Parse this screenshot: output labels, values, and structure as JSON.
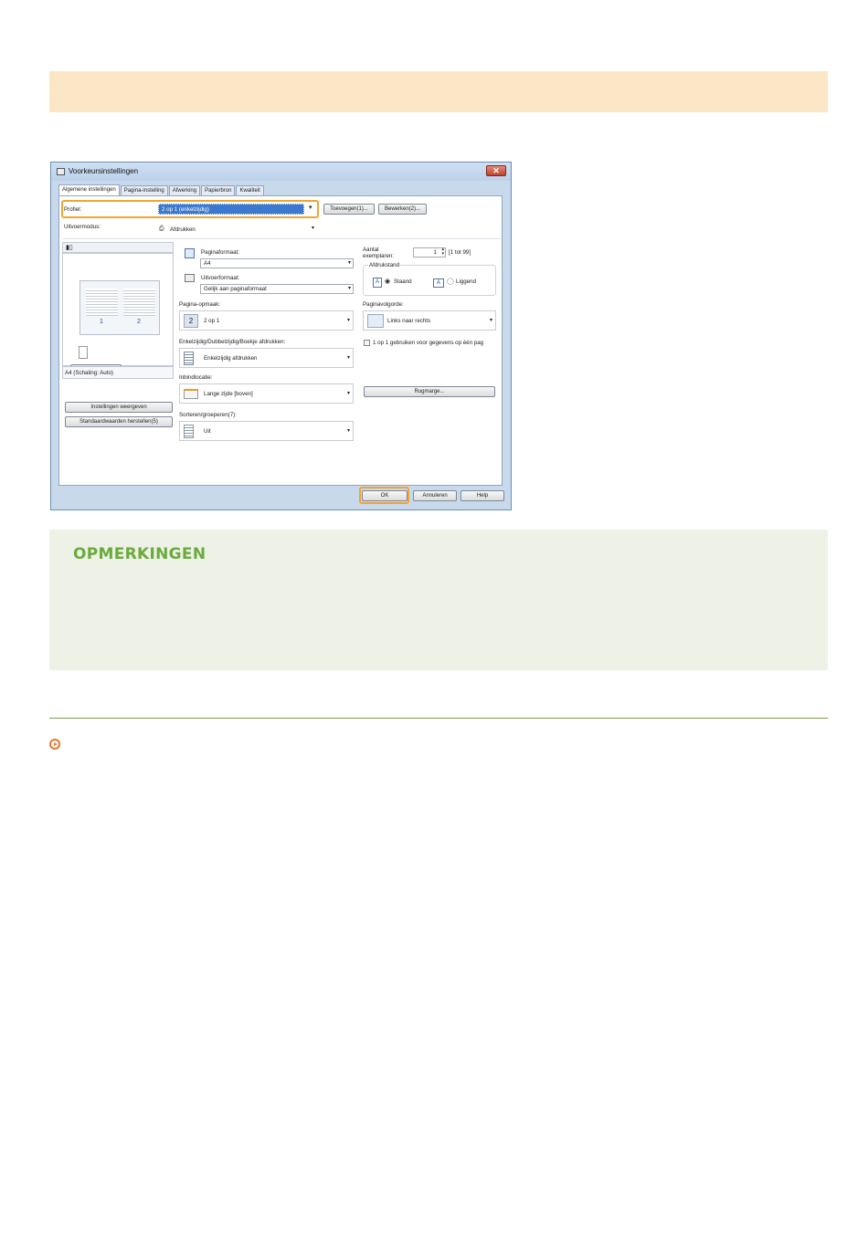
{
  "dialog": {
    "title": "Voorkeursinstellingen",
    "close": "✕",
    "tabs": [
      "Algemene instellingen",
      "Pagina-instelling",
      "Afwerking",
      "Papierbron",
      "Kwaliteit"
    ],
    "profile_label": "Profiel:",
    "profile_value": "2 op 1 (enkelzijdig)",
    "add_button": "Toevoegen(1)...",
    "edit_button": "Bewerken(2)...",
    "output_mode_label": "Uitvoermodus:",
    "output_mode_value": "Afdrukken",
    "preview_caption": "A4 (Schaling: Auto)",
    "preview_page_numbers": [
      "1",
      "2"
    ],
    "show_settings_button": "Instellingen weergeven",
    "restore_defaults_button": "Standaardwaarden herstellen(5)",
    "page_size_label": "Paginaformaat:",
    "page_size_value": "A4",
    "output_size_label": "Uitvoerformaat:",
    "output_size_value": "Gelijk aan paginaformaat",
    "copies_label": "Aantal exemplaren:",
    "copies_value": "1",
    "copies_range": "[1 tot 99]",
    "orientation_label": "Afdrukstand",
    "orientation_portrait": "Staand",
    "orientation_landscape": "Liggend",
    "page_layout_label": "Pagina-opmaak:",
    "page_layout_value": "2 op 1",
    "page_order_label": "Paginavolgorde:",
    "page_order_value": "Links naar rechts",
    "one_on_one_checkbox": "1 op 1 gebruiken voor gegevens op één pag",
    "duplex_label": "Enkelzijdig/Dubbelzijdig/Boekje afdrukken:",
    "duplex_value": "Enkelzijdig afdrukken",
    "binding_label": "Inbindlocatie:",
    "binding_value": "Lange zijde [boven]",
    "gutter_button": "Rugmarge...",
    "collate_label": "Sorteren/groeperen(7):",
    "collate_value": "Uit",
    "ok_button": "OK",
    "cancel_button": "Annuleren",
    "help_button": "Help"
  },
  "notes": {
    "title": "OPMERKINGEN"
  },
  "colors": {
    "banner": "#fbe7c6",
    "notes_bg": "#eef2e6",
    "notes_title": "#6aab3c",
    "highlight": "#f0a532",
    "link_marker": "#e27a2f"
  }
}
